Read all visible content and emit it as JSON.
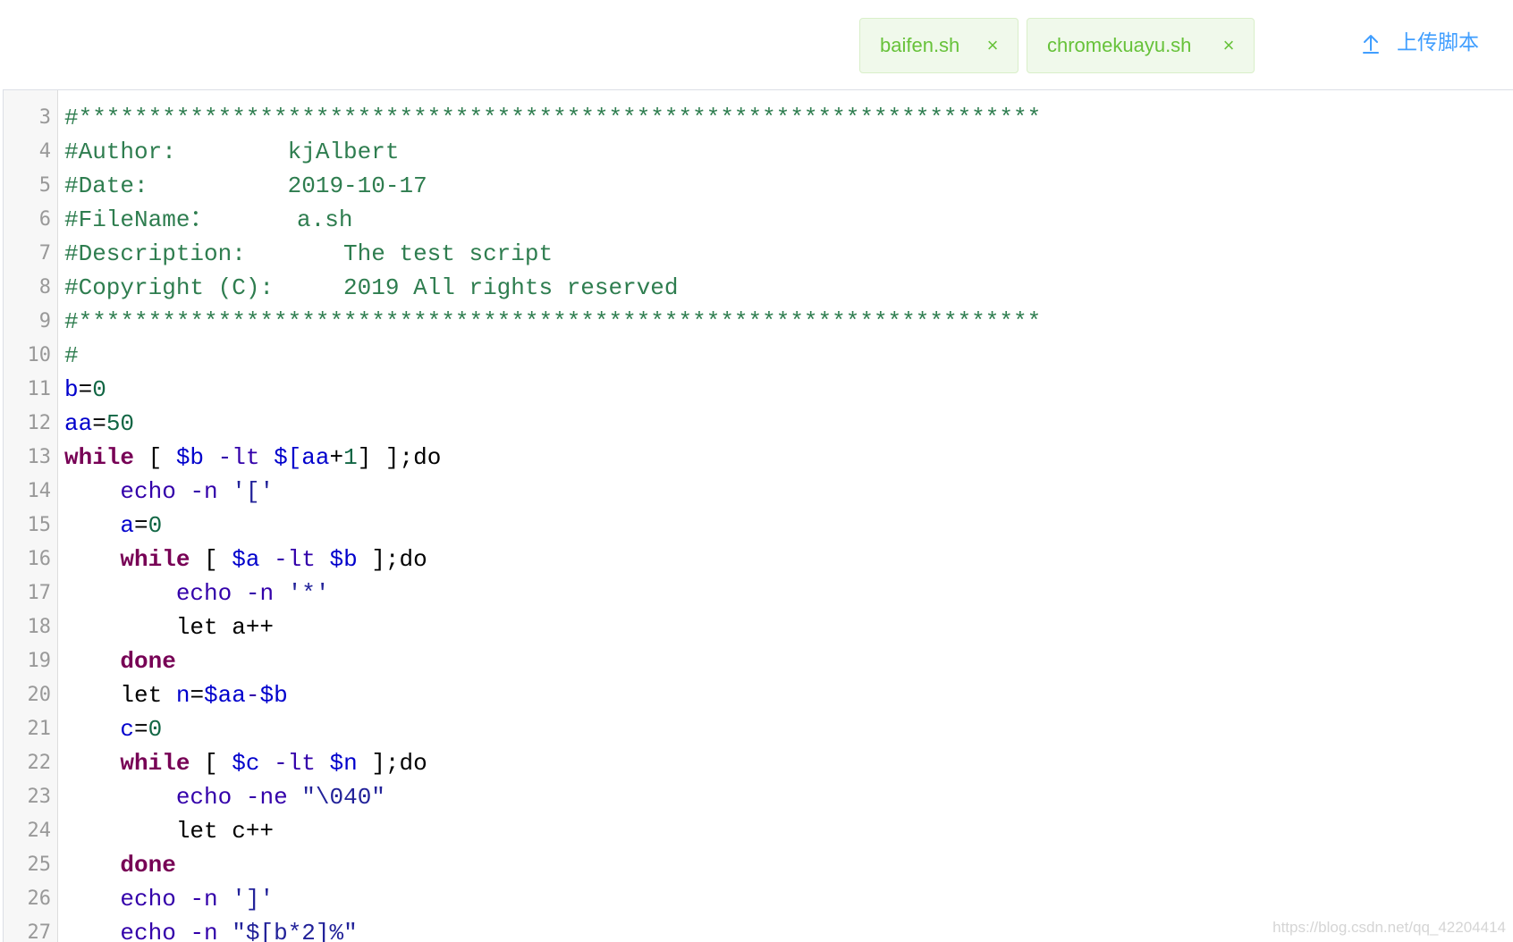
{
  "tabs": [
    {
      "label": "baifen.sh",
      "close": "×"
    },
    {
      "label": "chromekuayu.sh",
      "close": "×"
    }
  ],
  "upload": {
    "label": "上传脚本",
    "icon": "upload-icon"
  },
  "colors": {
    "tab_bg": "#f0f9eb",
    "tab_text": "#67c23a",
    "upload": "#409eff",
    "comment": "#2e7d4f",
    "keyword": "#770055",
    "variable": "#0000cc",
    "number": "#116644"
  },
  "editor": {
    "lines": [
      {
        "n": "3",
        "tokens": [
          {
            "t": "comment",
            "v": "#*********************************************************************"
          }
        ]
      },
      {
        "n": "4",
        "tokens": [
          {
            "t": "comment",
            "v": "#Author:        kjAlbert"
          }
        ]
      },
      {
        "n": "5",
        "tokens": [
          {
            "t": "comment",
            "v": "#Date:          2019-10-17"
          }
        ]
      },
      {
        "n": "6",
        "tokens": [
          {
            "t": "comment",
            "v": "#FileName：      a.sh"
          }
        ]
      },
      {
        "n": "7",
        "tokens": [
          {
            "t": "comment",
            "v": "#Description:       The test script"
          }
        ]
      },
      {
        "n": "8",
        "tokens": [
          {
            "t": "comment",
            "v": "#Copyright (C):     2019 All rights reserved"
          }
        ]
      },
      {
        "n": "9",
        "tokens": [
          {
            "t": "comment",
            "v": "#*********************************************************************"
          }
        ]
      },
      {
        "n": "10",
        "tokens": [
          {
            "t": "comment",
            "v": "#"
          }
        ]
      },
      {
        "n": "11",
        "tokens": [
          {
            "t": "variable",
            "v": "b"
          },
          {
            "t": "plain",
            "v": "="
          },
          {
            "t": "number",
            "v": "0"
          }
        ]
      },
      {
        "n": "12",
        "tokens": [
          {
            "t": "variable",
            "v": "aa"
          },
          {
            "t": "plain",
            "v": "="
          },
          {
            "t": "number",
            "v": "50"
          }
        ]
      },
      {
        "n": "13",
        "tokens": [
          {
            "t": "keyword",
            "v": "while"
          },
          {
            "t": "plain",
            "v": " [ "
          },
          {
            "t": "variable",
            "v": "$b"
          },
          {
            "t": "plain",
            "v": " "
          },
          {
            "t": "builtin",
            "v": "-lt"
          },
          {
            "t": "plain",
            "v": " "
          },
          {
            "t": "variable",
            "v": "$[aa"
          },
          {
            "t": "plain",
            "v": "+"
          },
          {
            "t": "number",
            "v": "1"
          },
          {
            "t": "plain",
            "v": "] ];do"
          }
        ]
      },
      {
        "n": "14",
        "tokens": [
          {
            "t": "plain",
            "v": "    "
          },
          {
            "t": "builtin",
            "v": "echo"
          },
          {
            "t": "plain",
            "v": " "
          },
          {
            "t": "builtin",
            "v": "-n"
          },
          {
            "t": "plain",
            "v": " "
          },
          {
            "t": "string",
            "v": "'['"
          }
        ]
      },
      {
        "n": "15",
        "tokens": [
          {
            "t": "plain",
            "v": "    "
          },
          {
            "t": "variable",
            "v": "a"
          },
          {
            "t": "plain",
            "v": "="
          },
          {
            "t": "number",
            "v": "0"
          }
        ]
      },
      {
        "n": "16",
        "tokens": [
          {
            "t": "plain",
            "v": "    "
          },
          {
            "t": "keyword",
            "v": "while"
          },
          {
            "t": "plain",
            "v": " [ "
          },
          {
            "t": "variable",
            "v": "$a"
          },
          {
            "t": "plain",
            "v": " "
          },
          {
            "t": "builtin",
            "v": "-lt"
          },
          {
            "t": "plain",
            "v": " "
          },
          {
            "t": "variable",
            "v": "$b"
          },
          {
            "t": "plain",
            "v": " ];do"
          }
        ]
      },
      {
        "n": "17",
        "tokens": [
          {
            "t": "plain",
            "v": "        "
          },
          {
            "t": "builtin",
            "v": "echo"
          },
          {
            "t": "plain",
            "v": " "
          },
          {
            "t": "builtin",
            "v": "-n"
          },
          {
            "t": "plain",
            "v": " "
          },
          {
            "t": "string",
            "v": "'*'"
          }
        ]
      },
      {
        "n": "18",
        "tokens": [
          {
            "t": "plain",
            "v": "        let a++"
          }
        ]
      },
      {
        "n": "19",
        "tokens": [
          {
            "t": "plain",
            "v": "    "
          },
          {
            "t": "keyword",
            "v": "done"
          }
        ]
      },
      {
        "n": "20",
        "tokens": [
          {
            "t": "plain",
            "v": "    let "
          },
          {
            "t": "variable",
            "v": "n"
          },
          {
            "t": "plain",
            "v": "="
          },
          {
            "t": "variable",
            "v": "$aa"
          },
          {
            "t": "builtin",
            "v": "-"
          },
          {
            "t": "variable",
            "v": "$b"
          }
        ]
      },
      {
        "n": "21",
        "tokens": [
          {
            "t": "plain",
            "v": "    "
          },
          {
            "t": "variable",
            "v": "c"
          },
          {
            "t": "plain",
            "v": "="
          },
          {
            "t": "number",
            "v": "0"
          }
        ]
      },
      {
        "n": "22",
        "tokens": [
          {
            "t": "plain",
            "v": "    "
          },
          {
            "t": "keyword",
            "v": "while"
          },
          {
            "t": "plain",
            "v": " [ "
          },
          {
            "t": "variable",
            "v": "$c"
          },
          {
            "t": "plain",
            "v": " "
          },
          {
            "t": "builtin",
            "v": "-lt"
          },
          {
            "t": "plain",
            "v": " "
          },
          {
            "t": "variable",
            "v": "$n"
          },
          {
            "t": "plain",
            "v": " ];do"
          }
        ]
      },
      {
        "n": "23",
        "tokens": [
          {
            "t": "plain",
            "v": "        "
          },
          {
            "t": "builtin",
            "v": "echo"
          },
          {
            "t": "plain",
            "v": " "
          },
          {
            "t": "builtin",
            "v": "-ne"
          },
          {
            "t": "plain",
            "v": " "
          },
          {
            "t": "string",
            "v": "\"\\040\""
          }
        ]
      },
      {
        "n": "24",
        "tokens": [
          {
            "t": "plain",
            "v": "        let c++"
          }
        ]
      },
      {
        "n": "25",
        "tokens": [
          {
            "t": "plain",
            "v": "    "
          },
          {
            "t": "keyword",
            "v": "done"
          }
        ]
      },
      {
        "n": "26",
        "tokens": [
          {
            "t": "plain",
            "v": "    "
          },
          {
            "t": "builtin",
            "v": "echo"
          },
          {
            "t": "plain",
            "v": " "
          },
          {
            "t": "builtin",
            "v": "-n"
          },
          {
            "t": "plain",
            "v": " "
          },
          {
            "t": "string",
            "v": "']'"
          }
        ]
      },
      {
        "n": "27",
        "tokens": [
          {
            "t": "plain",
            "v": "    "
          },
          {
            "t": "builtin",
            "v": "echo"
          },
          {
            "t": "plain",
            "v": " "
          },
          {
            "t": "builtin",
            "v": "-n"
          },
          {
            "t": "plain",
            "v": " "
          },
          {
            "t": "string",
            "v": "\"$[b*2]%\""
          }
        ]
      }
    ]
  },
  "watermark": "https://blog.csdn.net/qq_42204414"
}
